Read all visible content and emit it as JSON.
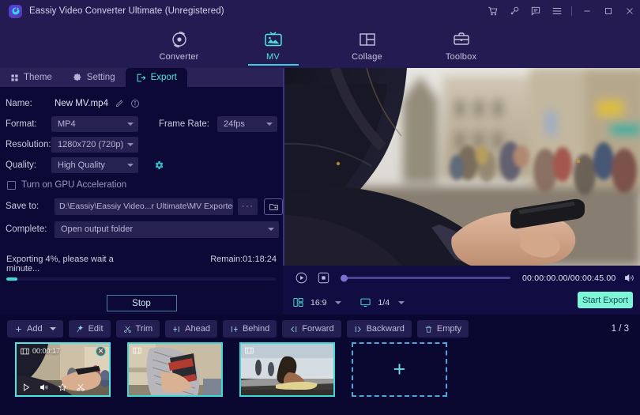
{
  "titlebar": {
    "app_title": "Eassiy Video Converter Ultimate (Unregistered)",
    "icons": [
      "cart-icon",
      "key-icon",
      "feedback-icon",
      "menu-icon",
      "minimize-icon",
      "maximize-icon",
      "close-icon"
    ]
  },
  "mainnav": {
    "items": [
      {
        "label": "Converter",
        "icon": "converter-icon",
        "active": false
      },
      {
        "label": "MV",
        "icon": "mv-icon",
        "active": true
      },
      {
        "label": "Collage",
        "icon": "collage-icon",
        "active": false
      },
      {
        "label": "Toolbox",
        "icon": "toolbox-icon",
        "active": false
      }
    ],
    "accent": "#4fe6e2"
  },
  "panel": {
    "tabs": [
      {
        "label": "Theme",
        "icon": "grid-icon",
        "active": false
      },
      {
        "label": "Setting",
        "icon": "gear-icon",
        "active": false
      },
      {
        "label": "Export",
        "icon": "export-icon",
        "active": true
      }
    ],
    "name_label": "Name:",
    "name_value": "New MV.mp4",
    "format_label": "Format:",
    "format_value": "MP4",
    "framerate_label": "Frame Rate:",
    "framerate_value": "24fps",
    "resolution_label": "Resolution:",
    "resolution_value": "1280x720 (720p)",
    "quality_label": "Quality:",
    "quality_value": "High Quality",
    "gpu_label": "Turn on GPU Acceleration",
    "gpu_checked": false,
    "saveto_label": "Save to:",
    "saveto_value": "D:\\Eassiy\\Eassiy Video...r Ultimate\\MV Exported",
    "browse_label": "···",
    "complete_label": "Complete:",
    "complete_value": "Open output folder",
    "progress_text": "Exporting 4%, please wait a minute...",
    "progress_percent": 4,
    "remain_text": "Remain:01:18:24",
    "stop_label": "Stop"
  },
  "player": {
    "timecode": "00:00:00.00/00:00:45.00",
    "aspect_ratio": "16:9",
    "screen_split": "1/4",
    "start_export_label": "Start Export",
    "start_export_color": "#7cf5d9"
  },
  "toolbar": {
    "buttons": [
      {
        "label": "Add",
        "icon": "plus-icon",
        "dropdown": true
      },
      {
        "label": "Edit",
        "icon": "wand-icon",
        "dropdown": false
      },
      {
        "label": "Trim",
        "icon": "scissors-icon",
        "dropdown": false
      },
      {
        "label": "Ahead",
        "icon": "insert-ahead-icon",
        "dropdown": false
      },
      {
        "label": "Behind",
        "icon": "insert-behind-icon",
        "dropdown": false
      },
      {
        "label": "Forward",
        "icon": "move-forward-icon",
        "dropdown": false
      },
      {
        "label": "Backward",
        "icon": "move-backward-icon",
        "dropdown": false
      },
      {
        "label": "Empty",
        "icon": "trash-icon",
        "dropdown": false
      }
    ],
    "pager": "1 / 3"
  },
  "thumbnails": [
    {
      "duration": "00:00:17",
      "selected": true,
      "tools": [
        "play-icon",
        "volume-icon",
        "effects-icon",
        "scissors-icon"
      ]
    },
    {
      "duration": "",
      "selected": false,
      "tools": []
    },
    {
      "duration": "",
      "selected": false,
      "tools": []
    }
  ],
  "add_tile": {
    "label": "+"
  }
}
